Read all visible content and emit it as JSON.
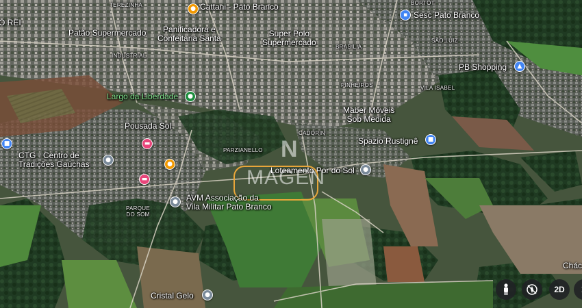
{
  "labels": {
    "terezinha": "TEREZINHA",
    "dorei": "O REI",
    "cattani": "Cattani - Pato Branco",
    "panificadora": "Panificadora e\nConfeitaria Santa",
    "patao": "Patão Supermercado",
    "superpolo": "Super Polo\nSupermercado",
    "industrial": "INDUSTRIAL",
    "brasilia": "BRASILIA",
    "bortot": "BORTOT",
    "sesc": "Sesc Pato Branco",
    "saoluiz": "SÃO LUIZ",
    "pbshopping": "PB Shopping",
    "pinheiros": "PINHEIROS",
    "vilaisabel": "VILA ISABEL",
    "largo": "Largo da Liberdade",
    "maber": "Maber Móveis\nSob Medida",
    "pousada": "Pousada Sol",
    "cadorin": "CADORIN",
    "ctg": "CTG - Centro de\nTradições Gaúchas",
    "parzianello": "PARZIANELLO",
    "spazio": "Spazio Rustignê",
    "loteamento": "Loteamento Por do Sol",
    "avm": "AVM Associação da\nVila Militar Pato Branco",
    "parque": "PARQUE\nDO SOM",
    "cristal": "Cristal Gelo",
    "chac": "Chác"
  },
  "watermark": {
    "text": "MAGEN",
    "logo": "N"
  },
  "controls": {
    "pegman": "pegman-icon",
    "compass": "compass-icon",
    "view_mode": "2D",
    "more": "chevron"
  },
  "colors": {
    "highlight": "#e8a63a",
    "pin_food": "#f29900",
    "pin_place": "#4285f4",
    "pin_park": "#1e8e3e",
    "pin_hotel": "#e8457a",
    "pin_generic": "#7a8a9a"
  }
}
